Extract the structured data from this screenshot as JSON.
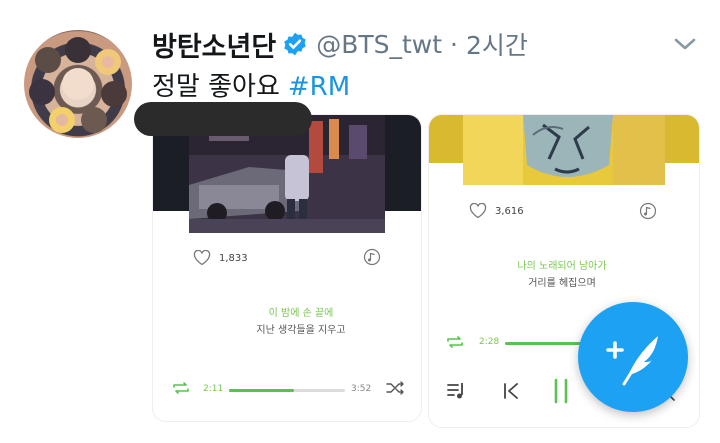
{
  "tweet": {
    "display_name": "방탄소년단",
    "handle": "@BTS_twt",
    "separator": "·",
    "time": "2시간",
    "text": "정말 좋아요",
    "hashtag": "#RM",
    "avatar_icon": "group-photo-avatar",
    "verified_icon": "verified-badge-icon",
    "menu_icon": "chevron-down-icon"
  },
  "card_left": {
    "likes": "1,833",
    "lyric_highlight": "이 밤에 손 끝에",
    "lyric_line": "지난 생각들을 지우고",
    "elapsed": "2:11",
    "duration": "3:52",
    "progress_fraction": 0.56,
    "icons": [
      "heart-icon",
      "music-note-icon",
      "repeat-icon",
      "shuffle-icon"
    ]
  },
  "card_right": {
    "likes": "3,616",
    "lyric_highlight": "나의 노래되어 남아가",
    "lyric_line": "거리를 헤집으며",
    "elapsed": "2:28",
    "icons": [
      "heart-icon",
      "music-note-icon",
      "repeat-icon",
      "playlist-icon",
      "previous-icon",
      "pause-icon",
      "search-icon"
    ]
  },
  "fab": {
    "icon": "compose-tweet-icon"
  },
  "colors": {
    "twitter_blue": "#1da1f2",
    "hashtag": "#1b95e0",
    "player_green": "#59c34f",
    "gray_text": "#657786"
  }
}
